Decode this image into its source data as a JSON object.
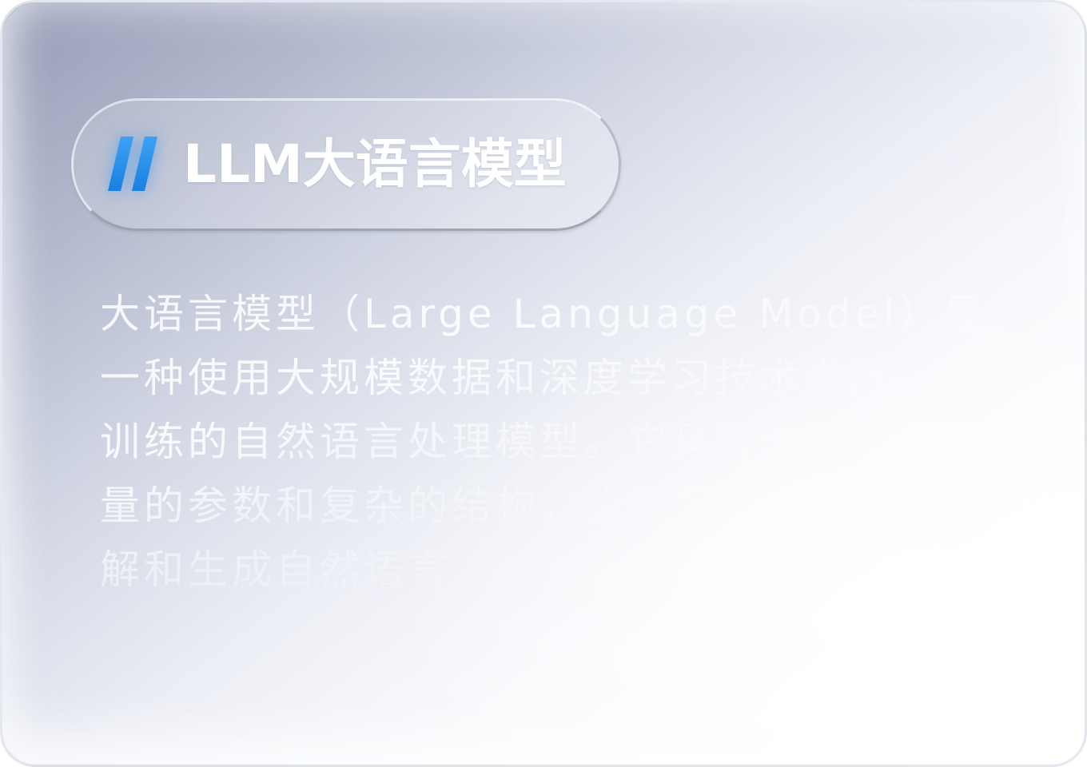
{
  "card": {
    "title": "LLM大语言模型",
    "icon": "double-slash-icon",
    "accent_color": "#2a8ee8",
    "description_lines": [
      "大语言模型（Large Language Model）是",
      "一种使用大规模数据和深度学习技术进行",
      "训练的自然语言处理模型。它具有大",
      "量的参数和复杂的结构，能够更好地理",
      "解和生成自然语言。"
    ]
  }
}
